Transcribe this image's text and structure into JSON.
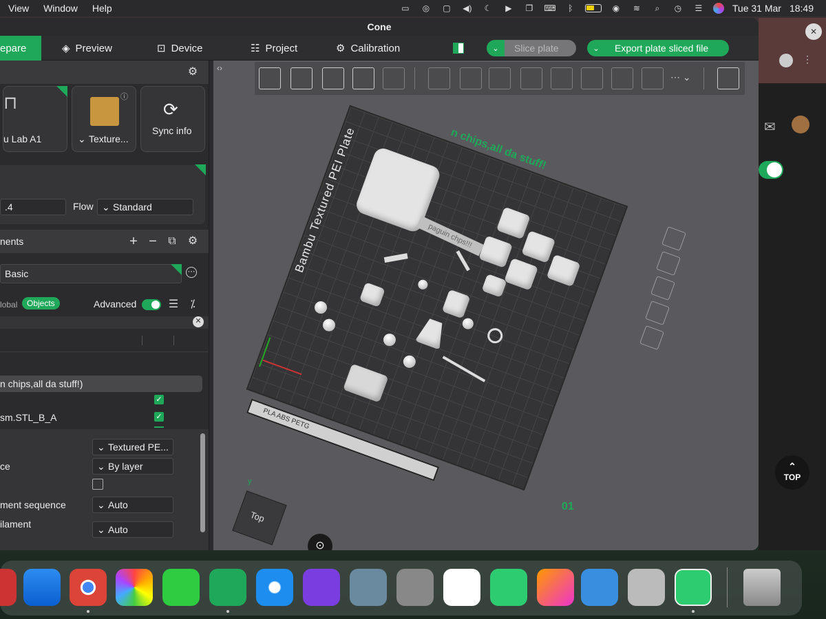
{
  "menubar": {
    "items": [
      "View",
      "Window",
      "Help"
    ],
    "date": "Tue 31 Mar",
    "time": "18:49"
  },
  "window": {
    "title": "Cone"
  },
  "tabs": {
    "prepare": "epare",
    "preview": "Preview",
    "device": "Device",
    "project": "Project",
    "calibration": "Calibration"
  },
  "actions": {
    "slice": "Slice plate",
    "export": "Export plate sliced file"
  },
  "printer": {
    "name": "u Lab A1",
    "plate": "Texture...",
    "sync": "Sync info"
  },
  "nozzle": {
    "value": ".4",
    "flow_label": "Flow",
    "flow_value": "Standard"
  },
  "filament": {
    "header": "nents",
    "preset": "Basic"
  },
  "process": {
    "global": "lobal",
    "objects": "Objects",
    "advanced": "Advanced"
  },
  "objects_list": {
    "plate_item": "n chips,all da stuff!)",
    "item2": "sm.STL_B_A"
  },
  "plate_settings": {
    "rows": [
      {
        "label": "",
        "value": "Textured PE..."
      },
      {
        "label": "ce",
        "value": "By layer"
      },
      {
        "label": "",
        "value": ""
      },
      {
        "label": "ment sequence",
        "value": "Auto"
      },
      {
        "label": "ilament",
        "value": "Auto"
      }
    ]
  },
  "viewport": {
    "plate_label": "Bambu Textured PEI Plate",
    "plate_title": "n chips,all da stuff!",
    "tag_text": "paguin chps!!!",
    "plate_number": "01",
    "cube_face": "Top",
    "axis_y": "y",
    "strip_text": "PLA ABS PETG"
  },
  "right": {
    "top_button": "TOP"
  },
  "colors": {
    "accent": "#1fa859",
    "panel": "#2b2b2e",
    "viewport": "#5a5a5e"
  }
}
